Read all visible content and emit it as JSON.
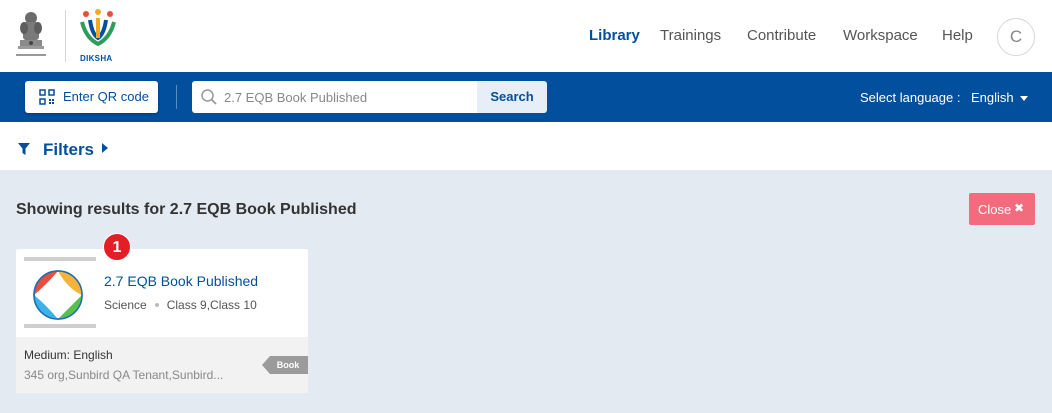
{
  "header": {
    "brand_text": "DIKSHA",
    "emblem_caption": "सत्यमेव जयते",
    "nav": [
      {
        "label": "Library",
        "active": true
      },
      {
        "label": "Trainings",
        "active": false
      },
      {
        "label": "Contribute",
        "active": false
      },
      {
        "label": "Workspace",
        "active": false
      },
      {
        "label": "Help",
        "active": false
      }
    ],
    "avatar_initial": "C"
  },
  "toolbar": {
    "qr_label": "Enter QR code",
    "search_value": "2.7 EQB Book Published",
    "search_label": "Search",
    "language_label": "Select language :",
    "language_value": "English"
  },
  "filters": {
    "label": "Filters"
  },
  "results": {
    "prefix": "Showing results for",
    "query": "2.7 EQB Book Published",
    "close_label": "Close"
  },
  "card": {
    "badge": "1",
    "title": "2.7 EQB Book Published",
    "subject": "Science",
    "classes": "Class 9,Class 10",
    "medium": "Medium: English",
    "org": "345 org,Sunbird QA Tenant,Sunbird...",
    "type_tag": "Book"
  },
  "colors": {
    "primary": "#024f9d",
    "page_bg": "#e3eaf2",
    "close_btn": "#f36c7e",
    "badge": "#e41e26"
  },
  "icons": [
    "emblem-icon",
    "diksha-logo-icon",
    "qr-code-icon",
    "search-icon",
    "caret-down-icon",
    "filter-icon",
    "caret-right-icon",
    "close-x-icon",
    "beach-ball-thumbnail"
  ]
}
